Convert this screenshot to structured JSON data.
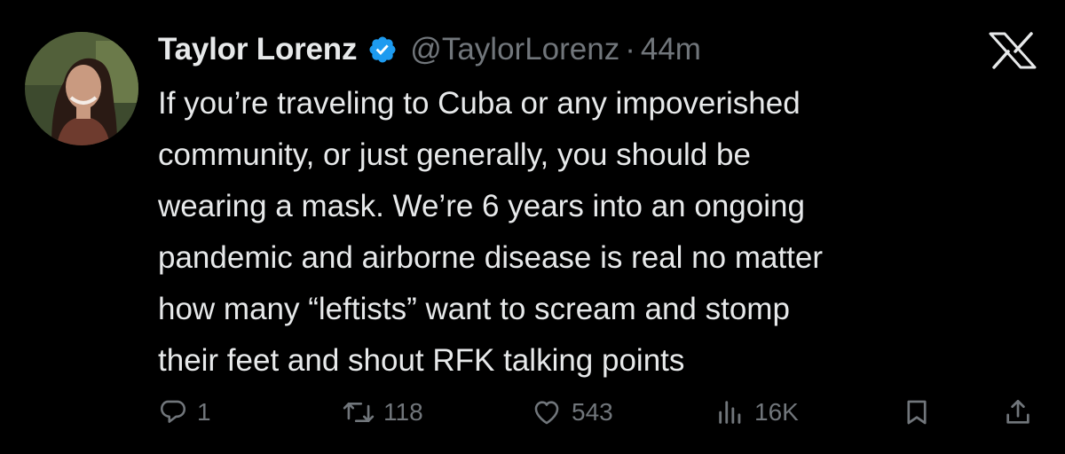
{
  "tweet": {
    "display_name": "Taylor Lorenz",
    "handle": "@TaylorLorenz",
    "separator": "·",
    "time": "44m",
    "verified": true,
    "lines": [
      "If you’re traveling to Cuba or any impoverished",
      "community, or just generally, you should be",
      "wearing a mask. We’re 6 years into an ongoing",
      "pandemic and airborne disease is real no matter",
      "how many “leftists” want to scream and stomp",
      "their feet and shout RFK talking points"
    ]
  },
  "actions": {
    "replies": "1",
    "reposts": "118",
    "likes": "543",
    "views": "16K"
  },
  "icons": {
    "verified": "verified-badge-icon",
    "logo": "x-logo-icon",
    "reply": "reply-icon",
    "repost": "repost-icon",
    "like": "heart-icon",
    "views": "views-icon",
    "bookmark": "bookmark-icon",
    "share": "share-icon"
  },
  "colors": {
    "background": "#000000",
    "text": "#e7e9ea",
    "secondary": "#71767b",
    "verified": "#1d9bf0"
  }
}
